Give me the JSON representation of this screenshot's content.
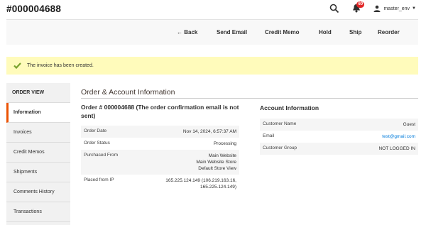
{
  "header": {
    "title": "#000004688",
    "notifications_count": "60",
    "user_name": "master_env",
    "icons": [
      "search-icon",
      "bell-icon",
      "user-icon",
      "chevron-down-icon"
    ]
  },
  "actions": {
    "back": "← Back",
    "send_email": "Send Email",
    "credit_memo": "Credit Memo",
    "hold": "Hold",
    "ship": "Ship",
    "reorder": "Reorder"
  },
  "message": {
    "text": "The invoice has been created.",
    "icon": "checkmark-icon",
    "accent": "#79a22e"
  },
  "sidebar": {
    "heading": "ORDER VIEW",
    "items": [
      {
        "label": "Information"
      },
      {
        "label": "Invoices"
      },
      {
        "label": "Credit Memos"
      },
      {
        "label": "Shipments"
      },
      {
        "label": "Comments History"
      },
      {
        "label": "Transactions"
      }
    ],
    "active_color": "#eb5202"
  },
  "main": {
    "section_title": "Order & Account Information",
    "order": {
      "title": "Order # 000004688 (The order confirmation email is not sent)",
      "rows": [
        {
          "label": "Order Date",
          "value": "Nov 14, 2024, 6:57:37 AM"
        },
        {
          "label": "Order Status",
          "value": "Processing"
        },
        {
          "label": "Purchased From",
          "value_lines": [
            "Main Website",
            "Main Website Store",
            "Default Store View"
          ]
        },
        {
          "label": "Placed from IP",
          "value_lines": [
            "165.225.124.149 (106.219.163.16,",
            "165.225.124.149)"
          ]
        }
      ]
    },
    "account": {
      "title": "Account Information",
      "rows": [
        {
          "label": "Customer Name",
          "value": "Guest"
        },
        {
          "label": "Email",
          "value": "test@gmail.com"
        },
        {
          "label": "Customer Group",
          "value": "NOT LOGGED IN"
        }
      ]
    }
  }
}
